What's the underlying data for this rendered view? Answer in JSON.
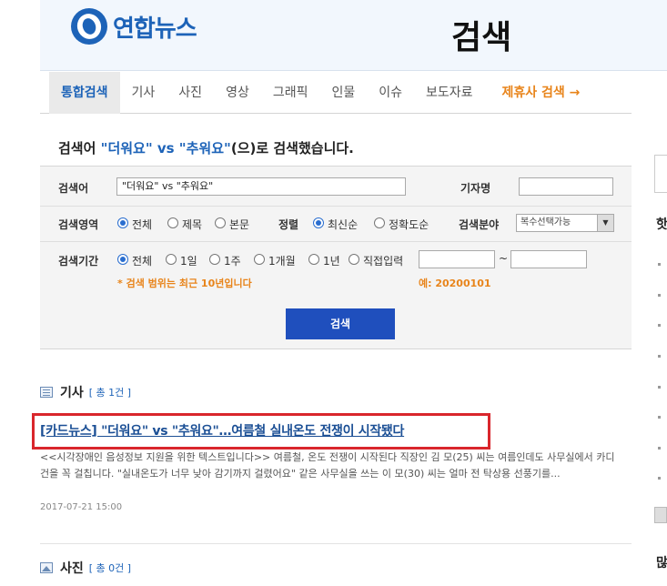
{
  "header": {
    "logo_text": "연합뉴스",
    "title": "검색"
  },
  "tabs": [
    {
      "label": "통합검색"
    },
    {
      "label": "기사"
    },
    {
      "label": "사진"
    },
    {
      "label": "영상"
    },
    {
      "label": "그래픽"
    },
    {
      "label": "인물"
    },
    {
      "label": "이슈"
    },
    {
      "label": "보도자료"
    }
  ],
  "partner_tab": "제휴사 검색 →",
  "summary": {
    "prefix": "검색어 ",
    "query": "\"더워요\" vs \"추워요\"",
    "suffix": "(으)로 검색했습니다."
  },
  "form": {
    "keyword_label": "검색어",
    "keyword_value": "\"더워요\" vs \"추워요\"",
    "reporter_label": "기자명",
    "reporter_value": "",
    "area_label": "검색영역",
    "area_options": [
      "전체",
      "제목",
      "본문"
    ],
    "sort_label": "정렬",
    "sort_options": [
      "최신순",
      "정확도순"
    ],
    "field_label": "검색분야",
    "field_value": "복수선택가능",
    "period_label": "검색기간",
    "period_options": [
      "전체",
      "1일",
      "1주",
      "1개월",
      "1년",
      "직접입력"
    ],
    "date_sep": "~",
    "note": "* 검색 범위는 최근 10년입니다",
    "example": "예: 20200101",
    "search_button": "검색"
  },
  "articles_section": {
    "title": "기사",
    "count": "[ 총 1건 ]"
  },
  "article": {
    "title": "[카드뉴스] \"더워요\" vs \"추워요\"…여름철 실내온도 전쟁이 시작됐다",
    "description": "<<시각장애인 음성정보 지원을 위한 텍스트입니다>> 여름철, 온도 전쟁이 시작된다 직장인 김 모(25) 씨는 여름인데도 사무실에서 카디건을 꼭 걸칩니다. \"실내온도가 너무 낮아 감기까지 걸렸어요\" 같은 사무실을 쓰는 이 모(30) 씨는 얼마 전 탁상용 선풍기를...",
    "date": "2017-07-21 15:00"
  },
  "photos_section": {
    "title": "사진",
    "count": "[ 총 0건 ]"
  },
  "sidebar": {
    "heading1": "핫",
    "heading2": "많"
  },
  "colors": {
    "brand_blue": "#1d63b8",
    "accent_orange": "#e8841a",
    "highlight_red": "#d9262c",
    "button_blue": "#1f4fbd"
  }
}
